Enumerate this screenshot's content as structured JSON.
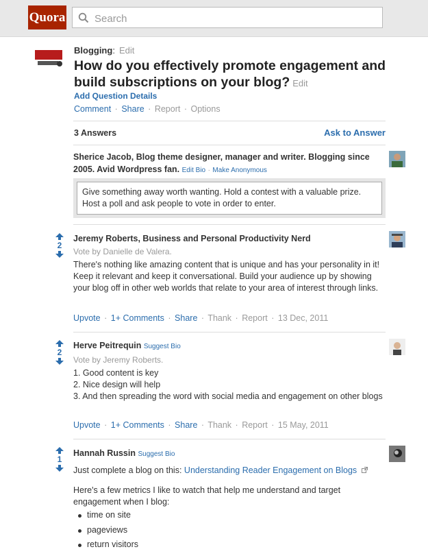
{
  "header": {
    "logo": "Quora",
    "search_placeholder": "Search"
  },
  "question": {
    "topic": "Blogging",
    "topic_colon": ":",
    "topic_edit": "Edit",
    "title": "How do you effectively promote engagement and build subscriptions on your blog?",
    "title_edit": "Edit",
    "add_details": "Add Question Details",
    "actions": {
      "comment": "Comment",
      "share": "Share",
      "report": "Report",
      "options": "Options",
      "separator": "·"
    }
  },
  "answers_header": {
    "count": "3 Answers",
    "ask": "Ask to Answer"
  },
  "my_answer": {
    "author": "Sherice Jacob, Blog theme designer, manager and writer. Blogging since 2005. Avid Wordpress fan.",
    "edit_bio": "Edit Bio",
    "make_anon": "Make Anonymous",
    "dot": "·",
    "draft": "Give something away worth wanting. Hold a contest with a valuable prize. Host a poll and ask people to vote in order to enter."
  },
  "answers": [
    {
      "votes": "2",
      "author": "Jeremy Roberts, Business and Personal Productivity Nerd",
      "vote_by": "Vote by Danielle de Valera.",
      "body": "There's nothing like amazing content that is unique and has your personality in it! Keep it relevant and keep it conversational. Build your audience up by showing your blog off in other web worlds that relate to your area of interest through links.",
      "upvote": "Upvote",
      "comments": "1+ Comments",
      "share": "Share",
      "thank": "Thank",
      "report": "Report",
      "date": "13 Dec, 2011"
    },
    {
      "votes": "2",
      "author": "Herve Peitrequin",
      "suggest_bio": "Suggest Bio",
      "vote_by": "Vote by Jeremy Roberts.",
      "lines": [
        "1. Good content is key",
        "2. Nice design will help",
        "3. And then spreading the word with social media and engagement on other blogs"
      ],
      "upvote": "Upvote",
      "comments": "1+ Comments",
      "share": "Share",
      "thank": "Thank",
      "report": "Report",
      "date": "15 May, 2011"
    },
    {
      "votes": "1",
      "author": "Hannah Russin",
      "suggest_bio": "Suggest Bio",
      "intro": "Just complete a blog on this:",
      "link": "Understanding Reader Engagement on Blogs",
      "para": "Here's a few metrics I like to watch that help me understand and target engagement when I blog:",
      "bullets": [
        "time on site",
        "pageviews",
        "return visitors"
      ]
    }
  ],
  "colors": {
    "brand": "#a82400",
    "link": "#2b6dad",
    "muted": "#999999"
  }
}
